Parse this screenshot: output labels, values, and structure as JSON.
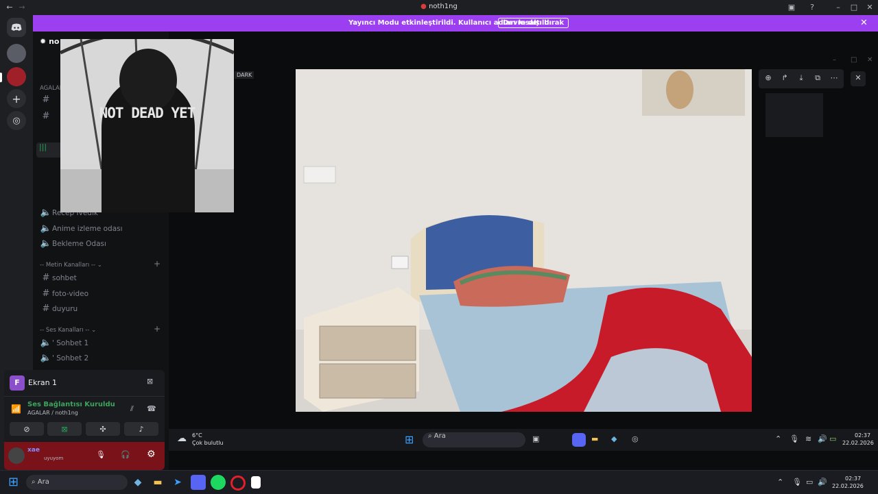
{
  "titlebar": {
    "title": "noth1ng"
  },
  "banner": {
    "message": "Yayıncı Modu etkinleştirildi. Kullanıcı adları kısaltıldı.",
    "button": "Devre dışı bırak"
  },
  "sidebar": {
    "server_prefix": "no",
    "dark_label": "DARK",
    "category_1": "AGALAR",
    "channels_top": [
      "Recep İvedik",
      "Anime izleme odası",
      "Bekleme Odası"
    ],
    "text_category": "-- Metin Kanalları --",
    "text_channels": [
      "sohbet",
      "foto-video",
      "duyuru"
    ],
    "voice_category": "-- Ses Kanalları --",
    "voice_channels": [
      "' Sohbet 1",
      "' Sohbet 2"
    ]
  },
  "thumbnail": {
    "hoodie_text": "NOT DEAD YET"
  },
  "voice_panel": {
    "stream_title": "Ekran 1",
    "stream_initial": "F",
    "connection_status": "Ses Bağlantısı Kuruldu",
    "connection_path": "AGALAR / noth1ng",
    "username": "xae",
    "user_status": "uyuyom",
    "status_color": "#3ba55d"
  },
  "inner_taskbar": {
    "weather_temp": "6°C",
    "weather_desc": "Çok bulutlu",
    "search_placeholder": "Ara",
    "time": "02:37",
    "date": "22.02.2026"
  },
  "taskbar": {
    "search_placeholder": "Ara",
    "time": "02:37",
    "date": "22.02.2026"
  }
}
